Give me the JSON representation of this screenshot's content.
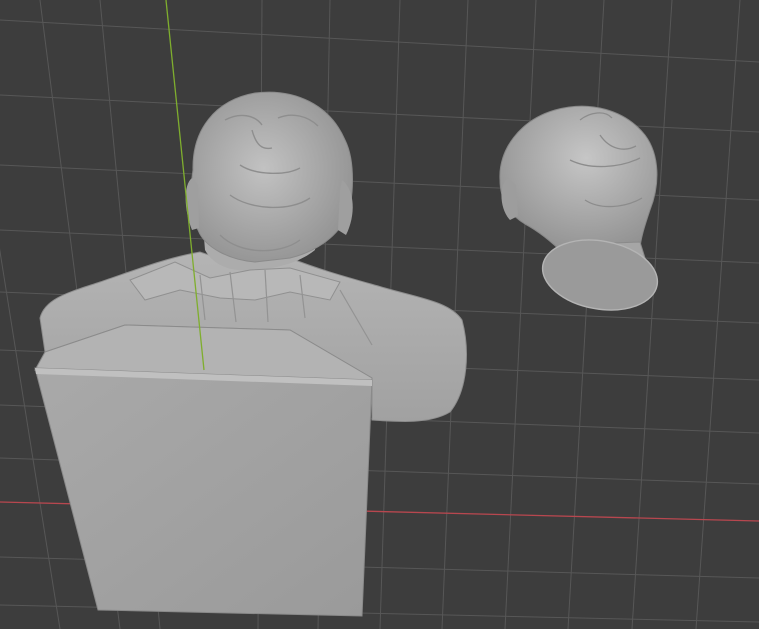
{
  "viewport": {
    "background": "#3d3d3d",
    "grid_color": "#575757",
    "x_axis_color": "#b8474f",
    "y_axis_color": "#7fae2e"
  },
  "objects": [
    {
      "name": "bust",
      "color": "#a3a3a3"
    },
    {
      "name": "head",
      "color": "#a0a0a0"
    }
  ]
}
